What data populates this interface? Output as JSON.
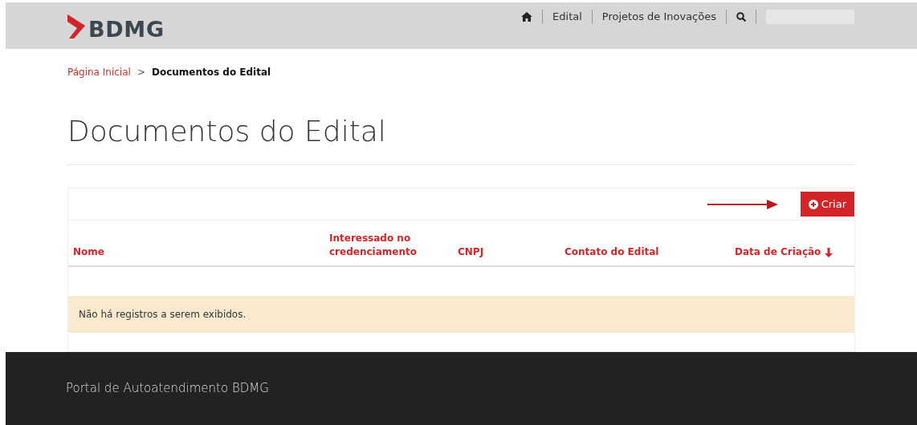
{
  "header": {
    "logo": "BDMG",
    "nav": [
      {
        "kind": "home"
      },
      {
        "kind": "link",
        "label": "Edital"
      },
      {
        "kind": "link",
        "label": "Projetos de Inovações"
      },
      {
        "kind": "search"
      },
      {
        "kind": "user"
      }
    ]
  },
  "breadcrumb": [
    {
      "label": "Página Inicial",
      "current": false
    },
    {
      "label": "Documentos do Edital",
      "current": true
    }
  ],
  "breadcrumb_separator": ">",
  "title": "Documentos do Edital",
  "create_button": "Criar",
  "table": {
    "columns": [
      {
        "label": "Nome",
        "sorted": false
      },
      {
        "label": "Interessado no credenciamento",
        "sorted": false
      },
      {
        "label": "CNPJ",
        "sorted": false
      },
      {
        "label": "Contato do Edital",
        "sorted": false
      },
      {
        "label": "Data de Criação",
        "sorted": true
      }
    ],
    "empty_message": "Não há registros a serem exibidos."
  },
  "footer": "Portal de Autoatendimento BDMG"
}
